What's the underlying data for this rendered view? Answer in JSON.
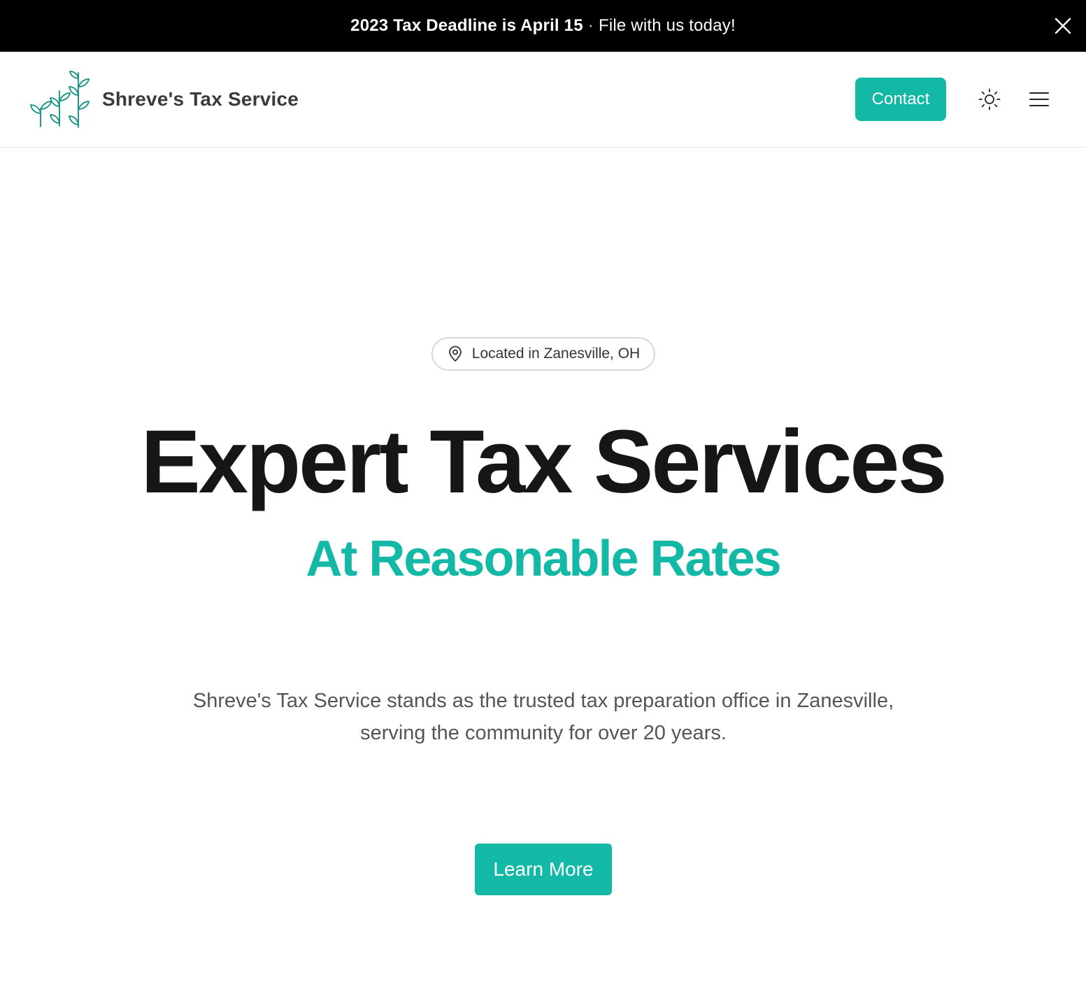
{
  "announcement": {
    "highlight": "2023 Tax Deadline is April 15",
    "separator": "·",
    "message": "File with us today!",
    "close_icon": "close-icon"
  },
  "header": {
    "brand_name": "Shreve's Tax Service",
    "logo_icon": "sprouting-plants-icon",
    "contact_label": "Contact",
    "theme_icon": "sun-icon",
    "menu_icon": "hamburger-menu-icon"
  },
  "hero": {
    "location_badge": "Located in Zanesville, OH",
    "location_icon": "map-pin-icon",
    "headline": "Expert Tax Services",
    "subheadline": "At Reasonable Rates",
    "description": "Shreve's Tax Service stands as the trusted tax preparation office in Zanesville, serving the community for over 20 years.",
    "cta_label": "Learn More"
  },
  "colors": {
    "accent": "#14b8a6",
    "announcement_bg": "#000000",
    "heading": "#161616",
    "body_text": "#555555"
  }
}
